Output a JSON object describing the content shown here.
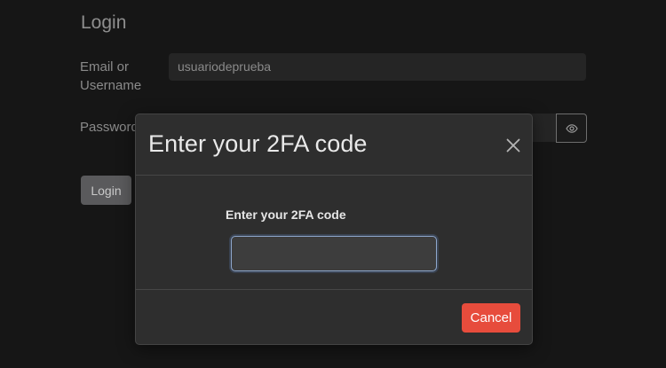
{
  "login_page": {
    "title": "Login",
    "email_label": "Email or Username",
    "username_value": "usuariodeprueba",
    "password_label": "Password",
    "password_toggle_icon": "eye-icon",
    "login_button": "Login"
  },
  "modal": {
    "title": "Enter your 2FA code",
    "close_icon": "close-icon",
    "code_label": "Enter your 2FA code",
    "code_value": "",
    "cancel_button": "Cancel"
  },
  "colors": {
    "background": "#161616",
    "modal_background": "#2e2e2e",
    "cancel_button": "#e74c3c",
    "input_focus_border": "#8ea7cc"
  }
}
